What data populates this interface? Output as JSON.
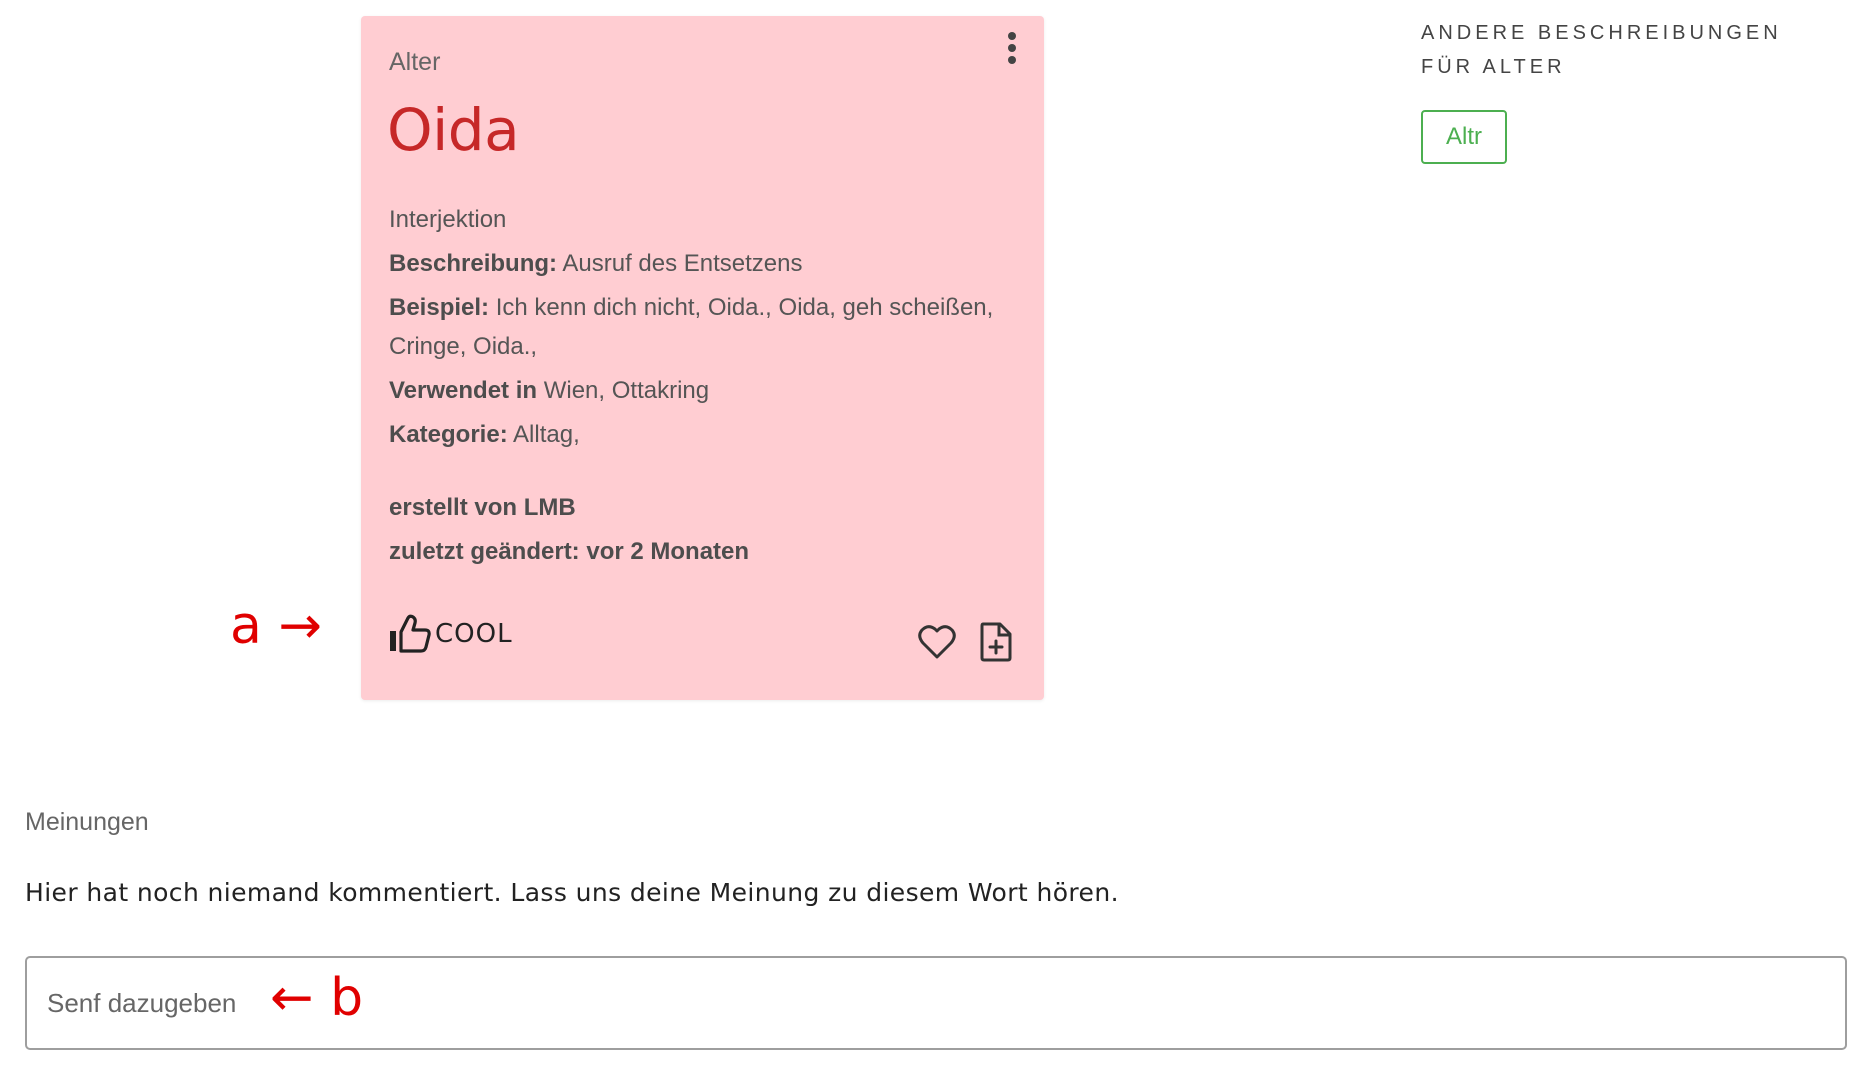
{
  "card": {
    "overline": "Alter",
    "title": "Oida",
    "word_type": "Interjektion",
    "description_label": "Beschreibung:",
    "description": " Ausruf des Entsetzens",
    "example_label": "Beispiel:",
    "example": " Ich kenn dich nicht, Oida., Oida, geh scheißen, Cringe, Oida.,",
    "used_in_label": "Verwendet in",
    "used_in": " Wien, Ottakring",
    "category_label": "Kategorie:",
    "category": " Alltag,",
    "created_by": "erstellt von LMB",
    "last_changed": "zuletzt geändert: vor 2 Monaten",
    "cool_label": "COOL",
    "icons": {
      "menu": "more-vert-icon",
      "cool": "thumbs-up-icon",
      "favorite": "heart-icon",
      "add": "file-plus-icon"
    }
  },
  "side": {
    "heading": "Andere Beschreibungen für Alter",
    "chips": [
      "Altr"
    ]
  },
  "annotations": {
    "a": "a →",
    "b": "← b"
  },
  "comments": {
    "label": "Meinungen",
    "empty_text": "Hier hat noch niemand kommentiert. Lass uns deine Meinung zu diesem Wort hören.",
    "input_placeholder": "Senf dazugeben"
  },
  "colors": {
    "card_bg": "#ffcdd2",
    "title": "#c62828",
    "chip": "#4caf50",
    "annotation": "#e00000"
  }
}
